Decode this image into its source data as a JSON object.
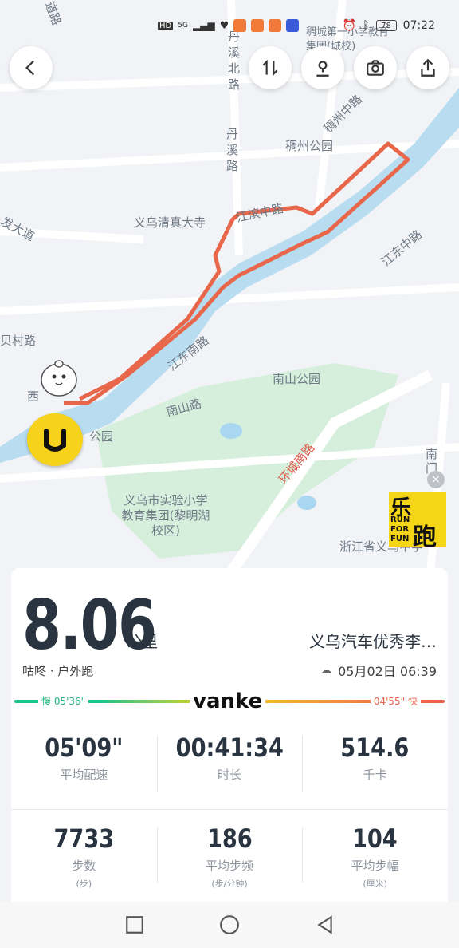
{
  "status_bar": {
    "network_label": "HD",
    "network_type": "5G",
    "battery": "78",
    "time": "07:22"
  },
  "map": {
    "labels": {
      "chouzhou_park": "稠州公园",
      "danxi_road": "丹溪路",
      "danxi_north_road": "丹溪北路",
      "chouzhou_middle_road": "稠州中路",
      "yiwu_mosque": "义乌清真大寺",
      "jiangbin_road": "江滨中路",
      "jiangdong_road": "江东中路",
      "jiangdong_south_road": "江东南路",
      "nanshan_park": "南山公园",
      "nanshan_road": "南山路",
      "huancheng_south_road": "环城南路",
      "experimental_school": "义乌市实验小学教育集团(黎明湖校区)",
      "zhejiang_province": "浙江省义乌中学",
      "chouchengdi_school": "稠城第一小学教育集团(城校)",
      "park_left": "公园",
      "road_left_1": "道路",
      "road_left_2": "发大道",
      "road_left_3": "贝村路",
      "road_left_4": "西",
      "road_right_1": "南门"
    },
    "leparty_badge": {
      "line1": "乐",
      "line2": "RUN",
      "line3": "FOR",
      "line4": "FUN",
      "line5": "跑"
    },
    "route_color": "#e8664a",
    "river_color": "#b8dcf0",
    "park_color": "#d9f0e0"
  },
  "card": {
    "distance": "8.06",
    "distance_unit": "公里",
    "title": "义乌汽车优秀李…",
    "app_source": "咕咚 · 户外跑",
    "date_time": "05月02日 06:39",
    "pace_slow": "慢 05'36\"",
    "pace_fast": "04'55\" 快",
    "brand": "vanke",
    "stats_row1": [
      {
        "value": "05'09\"",
        "label": "平均配速"
      },
      {
        "value": "00:41:34",
        "label": "时长"
      },
      {
        "value": "514.6",
        "label": "千卡"
      }
    ],
    "stats_row2": [
      {
        "value": "7733",
        "label": "步数",
        "unit": "(步)"
      },
      {
        "value": "186",
        "label": "平均步频",
        "unit": "(步/分钟)"
      },
      {
        "value": "104",
        "label": "平均步幅",
        "unit": "(厘米)"
      }
    ]
  }
}
